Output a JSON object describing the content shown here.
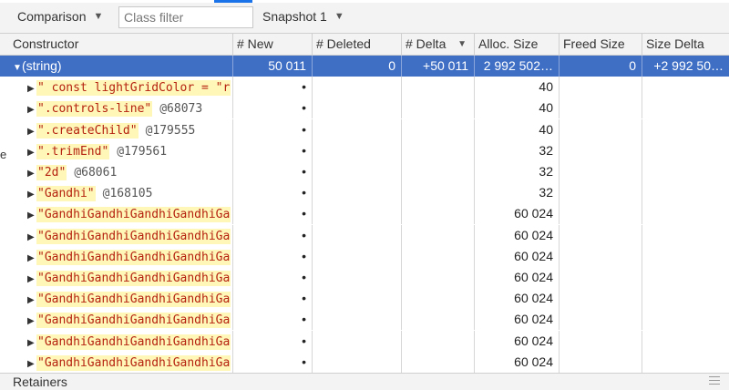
{
  "toolbar": {
    "view_label": "Comparison",
    "filter_placeholder": "Class filter",
    "snapshot_label": "Snapshot 1"
  },
  "columns": [
    "Constructor",
    "# New",
    "# Deleted",
    "# Delta",
    "Alloc. Size",
    "Freed Size",
    "Size Delta"
  ],
  "sorted_column": "# Delta",
  "rows": [
    {
      "ctor": "(string)",
      "new": "50 011",
      "deleted": "0",
      "delta": "+50 011",
      "alloc": "2 992 502…",
      "freed": "0",
      "sizedelta": "+2 992 50…",
      "selected": true,
      "expanded": true
    },
    {
      "ctor": "\" const lightGridColor = \"r",
      "objid": "",
      "new": "•",
      "alloc": "40"
    },
    {
      "ctor": "\".controls-line\"",
      "objid": "@68073",
      "new": "•",
      "alloc": "40"
    },
    {
      "ctor": "\".createChild\"",
      "objid": "@179555",
      "new": "•",
      "alloc": "40"
    },
    {
      "ctor": "\".trimEnd\"",
      "objid": "@179561",
      "new": "•",
      "alloc": "32"
    },
    {
      "ctor": "\"2d\"",
      "objid": "@68061",
      "new": "•",
      "alloc": "32"
    },
    {
      "ctor": "\"Gandhi\"",
      "objid": "@168105",
      "new": "•",
      "alloc": "32"
    },
    {
      "ctor": "\"GandhiGandhiGandhiGandhiGa",
      "objid": "",
      "new": "•",
      "alloc": "60 024"
    },
    {
      "ctor": "\"GandhiGandhiGandhiGandhiGa",
      "objid": "",
      "new": "•",
      "alloc": "60 024"
    },
    {
      "ctor": "\"GandhiGandhiGandhiGandhiGa",
      "objid": "",
      "new": "•",
      "alloc": "60 024"
    },
    {
      "ctor": "\"GandhiGandhiGandhiGandhiGa",
      "objid": "",
      "new": "•",
      "alloc": "60 024"
    },
    {
      "ctor": "\"GandhiGandhiGandhiGandhiGa",
      "objid": "",
      "new": "•",
      "alloc": "60 024"
    },
    {
      "ctor": "\"GandhiGandhiGandhiGandhiGa",
      "objid": "",
      "new": "•",
      "alloc": "60 024"
    },
    {
      "ctor": "\"GandhiGandhiGandhiGandhiGa",
      "objid": "",
      "new": "•",
      "alloc": "60 024"
    },
    {
      "ctor": "\"GandhiGandhiGandhiGandhiGa",
      "objid": "",
      "new": "•",
      "alloc": "60 024"
    }
  ],
  "retainers_label": "Retainers",
  "left_edge_glyph": "e",
  "colors": {
    "selection": "#3f6fc5",
    "string_text": "#b5220f",
    "string_bg": "#fff7b8",
    "accent": "#1a73e8"
  }
}
